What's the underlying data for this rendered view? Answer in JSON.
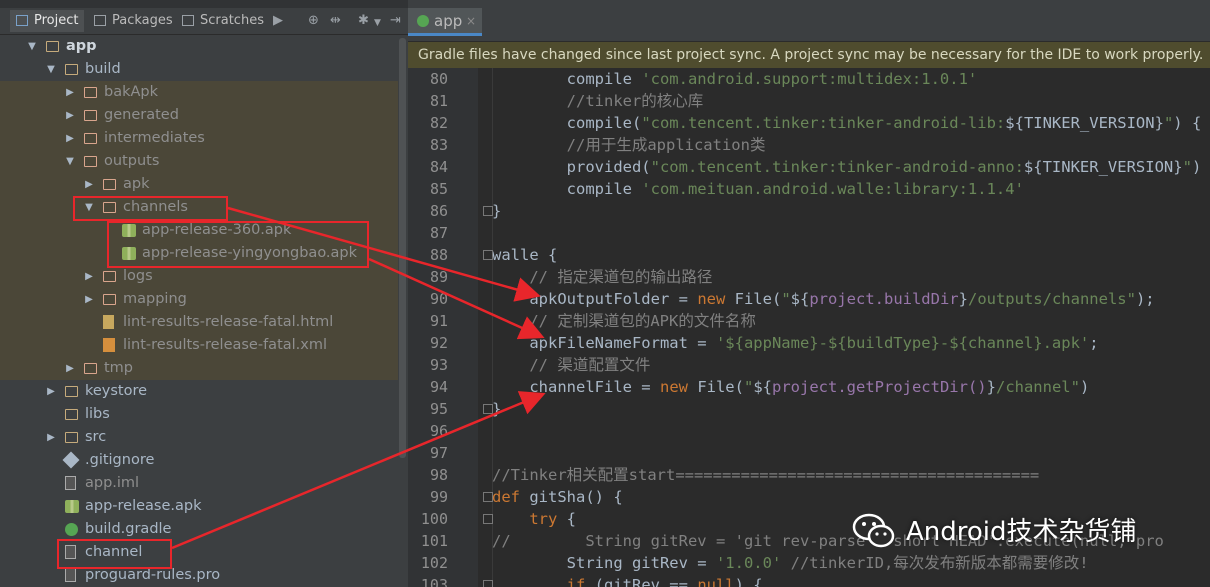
{
  "project_panel": {
    "tabs": [
      {
        "label": "Project",
        "selected": true
      },
      {
        "label": "Packages",
        "selected": false
      },
      {
        "label": "Scratches",
        "selected": false
      }
    ],
    "tree": [
      {
        "label": "app",
        "depth": 0,
        "icon": "module-folder",
        "arrow": "expanded",
        "bold": true
      },
      {
        "label": "build",
        "depth": 1,
        "icon": "folder",
        "arrow": "expanded"
      },
      {
        "label": "bakApk",
        "depth": 2,
        "icon": "excluded-folder",
        "arrow": "collapsed",
        "excluded": true
      },
      {
        "label": "generated",
        "depth": 2,
        "icon": "excluded-folder",
        "arrow": "collapsed",
        "excluded": true
      },
      {
        "label": "intermediates",
        "depth": 2,
        "icon": "excluded-folder",
        "arrow": "collapsed",
        "excluded": true
      },
      {
        "label": "outputs",
        "depth": 2,
        "icon": "excluded-folder",
        "arrow": "expanded",
        "excluded": true
      },
      {
        "label": "apk",
        "depth": 3,
        "icon": "excluded-folder",
        "arrow": "collapsed",
        "excluded": true
      },
      {
        "label": "channels",
        "depth": 3,
        "icon": "excluded-folder",
        "arrow": "expanded",
        "excluded": true
      },
      {
        "label": "app-release-360.apk",
        "depth": 4,
        "icon": "apk-file",
        "arrow": "none",
        "excluded": true
      },
      {
        "label": "app-release-yingyongbao.apk",
        "depth": 4,
        "icon": "apk-file",
        "arrow": "none",
        "excluded": true
      },
      {
        "label": "logs",
        "depth": 3,
        "icon": "excluded-folder",
        "arrow": "collapsed",
        "excluded": true
      },
      {
        "label": "mapping",
        "depth": 3,
        "icon": "excluded-folder",
        "arrow": "collapsed",
        "excluded": true
      },
      {
        "label": "lint-results-release-fatal.html",
        "depth": 3,
        "icon": "html-file",
        "arrow": "none",
        "excluded": true
      },
      {
        "label": "lint-results-release-fatal.xml",
        "depth": 3,
        "icon": "xml-file",
        "arrow": "none",
        "excluded": true
      },
      {
        "label": "tmp",
        "depth": 2,
        "icon": "excluded-folder",
        "arrow": "collapsed",
        "excluded": true
      },
      {
        "label": "keystore",
        "depth": 1,
        "icon": "folder",
        "arrow": "collapsed"
      },
      {
        "label": "libs",
        "depth": 1,
        "icon": "folder",
        "arrow": "none"
      },
      {
        "label": "src",
        "depth": 1,
        "icon": "folder",
        "arrow": "collapsed"
      },
      {
        "label": ".gitignore",
        "depth": 1,
        "icon": "gitignore-file",
        "arrow": "none"
      },
      {
        "label": "app.iml",
        "depth": 1,
        "icon": "iml-file",
        "arrow": "none",
        "dim": true
      },
      {
        "label": "app-release.apk",
        "depth": 1,
        "icon": "apk-file",
        "arrow": "none"
      },
      {
        "label": "build.gradle",
        "depth": 1,
        "icon": "gradle-file",
        "arrow": "none"
      },
      {
        "label": "channel",
        "depth": 1,
        "icon": "text-file",
        "arrow": "none"
      },
      {
        "label": "proguard-rules.pro",
        "depth": 1,
        "icon": "text-file",
        "arrow": "none"
      }
    ]
  },
  "editor": {
    "tab_label": "app",
    "tab_close": "×",
    "banner": "Gradle files have changed since last project sync. A project sync may be necessary for the IDE to work properly.",
    "lines": [
      {
        "n": "80",
        "parts": [
          [
            "p",
            "        compile "
          ],
          [
            "s",
            "'com.android.support:multidex:1.0.1'"
          ]
        ]
      },
      {
        "n": "81",
        "parts": [
          [
            "c",
            "        //tinker的核心库"
          ]
        ]
      },
      {
        "n": "82",
        "parts": [
          [
            "p",
            "        compile("
          ],
          [
            "s",
            "\"com.tencent.tinker:tinker-android-lib:"
          ],
          [
            "p",
            "${"
          ],
          [
            "p",
            "TINKER_VERSION"
          ],
          [
            "p",
            "}"
          ],
          [
            "s",
            "\""
          ],
          [
            "p",
            ") {"
          ]
        ]
      },
      {
        "n": "83",
        "parts": [
          [
            "c",
            "        //用于生成application类"
          ]
        ]
      },
      {
        "n": "84",
        "parts": [
          [
            "p",
            "        provided("
          ],
          [
            "s",
            "\"com.tencent.tinker:tinker-android-anno:"
          ],
          [
            "p",
            "${"
          ],
          [
            "p",
            "TINKER_VERSION"
          ],
          [
            "p",
            "}"
          ],
          [
            "s",
            "\""
          ],
          [
            "p",
            ")"
          ]
        ]
      },
      {
        "n": "85",
        "parts": [
          [
            "p",
            "        compile "
          ],
          [
            "s",
            "'com.meituan.android.walle:library:1.1.4'"
          ]
        ]
      },
      {
        "n": "86",
        "parts": [
          [
            "p",
            "}"
          ]
        ]
      },
      {
        "n": "87",
        "parts": []
      },
      {
        "n": "88",
        "parts": [
          [
            "p",
            "walle {"
          ]
        ]
      },
      {
        "n": "89",
        "parts": [
          [
            "c",
            "    // 指定渠道包的输出路径"
          ]
        ]
      },
      {
        "n": "90",
        "parts": [
          [
            "p",
            "    apkOutputFolder = "
          ],
          [
            "k",
            "new "
          ],
          [
            "p",
            "File("
          ],
          [
            "s",
            "\""
          ],
          [
            "p",
            "${"
          ],
          [
            "v",
            "project.buildDir"
          ],
          [
            "p",
            "}"
          ],
          [
            "s",
            "/outputs/channels\""
          ],
          [
            "p",
            ");"
          ]
        ]
      },
      {
        "n": "91",
        "parts": [
          [
            "c",
            "    // 定制渠道包的APK的文件名称"
          ]
        ]
      },
      {
        "n": "92",
        "parts": [
          [
            "p",
            "    apkFileNameFormat = "
          ],
          [
            "s",
            "'${appName}-${buildType}-${channel}.apk'"
          ],
          [
            "p",
            ";"
          ]
        ]
      },
      {
        "n": "93",
        "parts": [
          [
            "c",
            "    // 渠道配置文件"
          ]
        ]
      },
      {
        "n": "94",
        "parts": [
          [
            "p",
            "    channelFile = "
          ],
          [
            "k",
            "new "
          ],
          [
            "p",
            "File("
          ],
          [
            "s",
            "\""
          ],
          [
            "p",
            "${"
          ],
          [
            "v",
            "project.getProjectDir()"
          ],
          [
            "p",
            "}"
          ],
          [
            "s",
            "/channel\""
          ],
          [
            "p",
            ")"
          ]
        ]
      },
      {
        "n": "95",
        "parts": [
          [
            "p",
            "}"
          ]
        ]
      },
      {
        "n": "96",
        "parts": []
      },
      {
        "n": "97",
        "parts": []
      },
      {
        "n": "98",
        "parts": [
          [
            "c",
            "//Tinker相关配置start======================================="
          ]
        ]
      },
      {
        "n": "99",
        "parts": [
          [
            "k",
            "def "
          ],
          [
            "p",
            "gitSha() {"
          ]
        ]
      },
      {
        "n": "100",
        "parts": [
          [
            "k",
            "    try "
          ],
          [
            "p",
            "{"
          ]
        ]
      },
      {
        "n": "101",
        "parts": [
          [
            "c",
            "//        String gitRev = 'git rev-parse --short HEAD'.execute(null, pro"
          ]
        ]
      },
      {
        "n": "102",
        "parts": [
          [
            "p",
            "        String gitRev = "
          ],
          [
            "s",
            "'1.0.0'"
          ],
          [
            "c",
            " //tinkerID,每次发布新版本都需要修改!"
          ]
        ]
      },
      {
        "n": "103",
        "parts": [
          [
            "k",
            "        if "
          ],
          [
            "p",
            "(gitRev == "
          ],
          [
            "k",
            "null"
          ],
          [
            "p",
            ") {"
          ]
        ]
      }
    ]
  },
  "watermark": "Android技术杂货铺",
  "colors": {
    "annotation_red": "#e8262b",
    "accent_blue": "#4a88c7",
    "string_green": "#6a8759",
    "keyword_orange": "#cc7832",
    "comment_gray": "#808080",
    "field_purple": "#9876aa"
  }
}
